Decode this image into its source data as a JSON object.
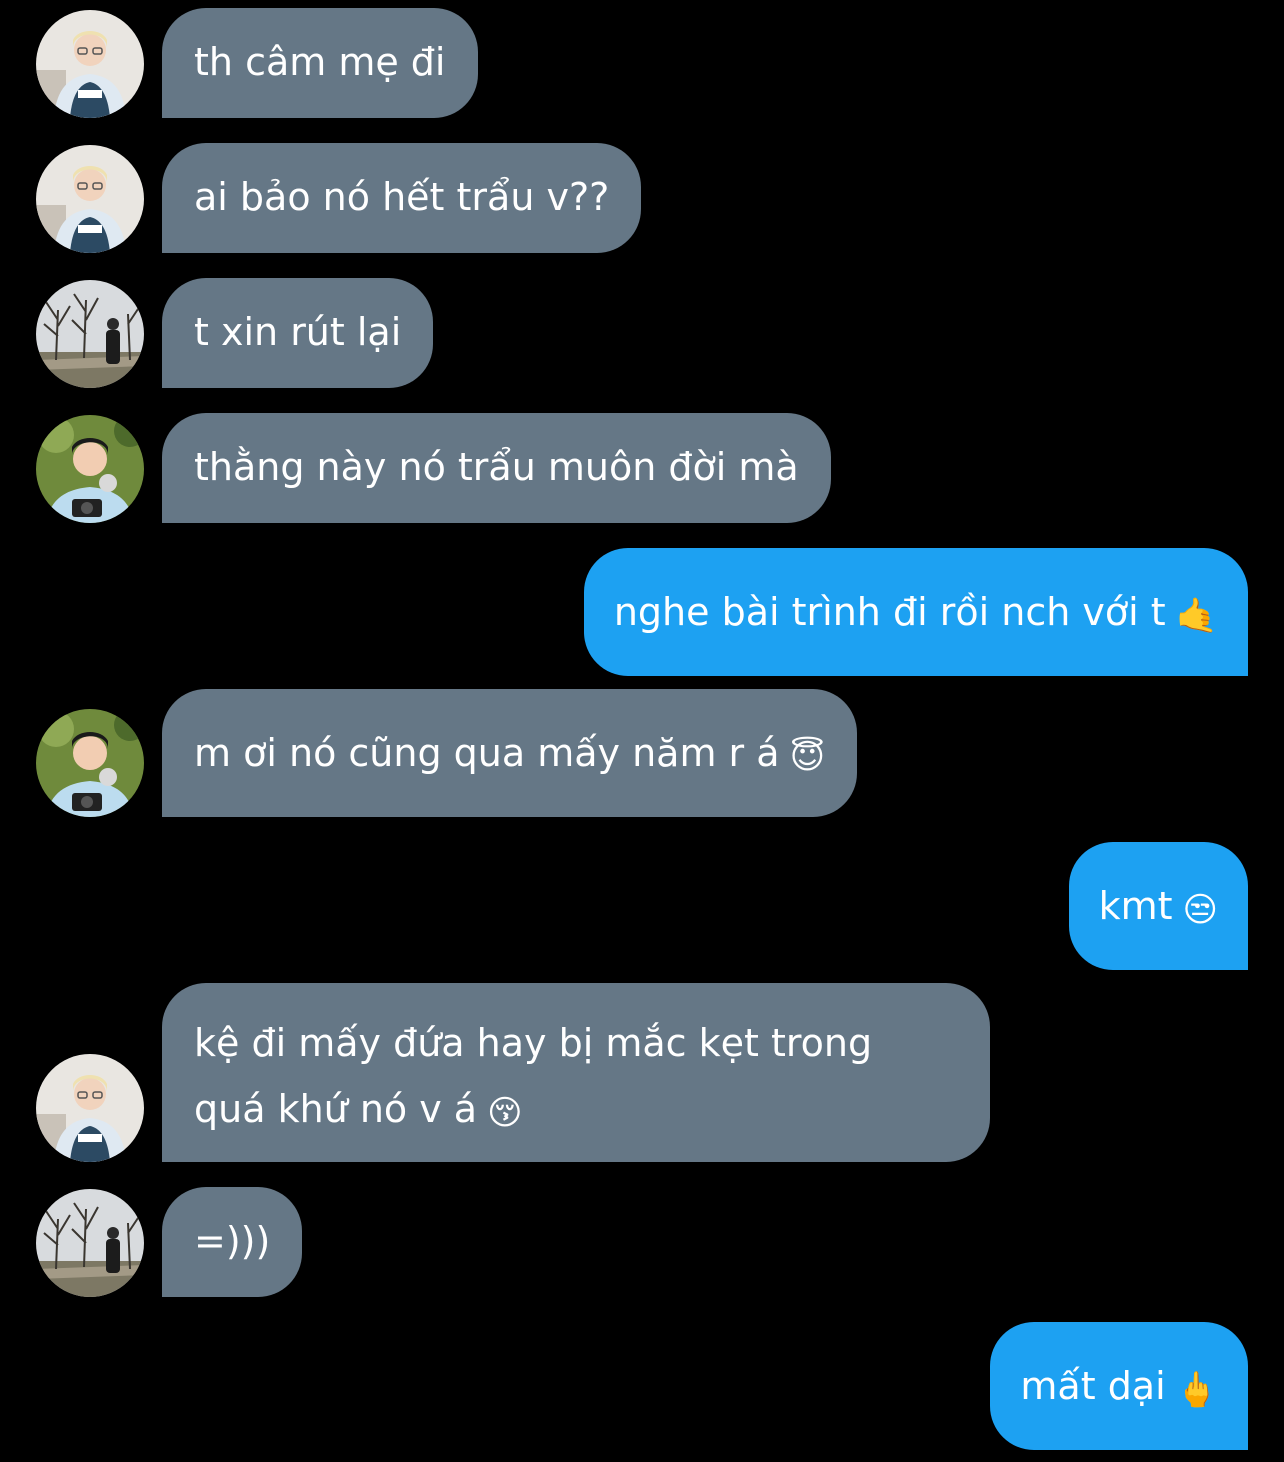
{
  "messages": [
    {
      "id": "m1",
      "direction": "in",
      "sender_avatar": "avatar-blond-jacket",
      "text": "th câm mẹ đi"
    },
    {
      "id": "m2",
      "direction": "in",
      "sender_avatar": "avatar-blond-jacket",
      "text": "ai bảo nó hết trẩu v??"
    },
    {
      "id": "m3",
      "direction": "in",
      "sender_avatar": "avatar-trees-park",
      "text": "t xin rút lại"
    },
    {
      "id": "m4",
      "direction": "in",
      "sender_avatar": "avatar-camera-green",
      "text": "thằng này nó trẩu muôn đời mà"
    },
    {
      "id": "m5",
      "direction": "out",
      "text": "nghe bài trình đi rồi nch với t",
      "emoji": "🤙"
    },
    {
      "id": "m6",
      "direction": "in",
      "sender_avatar": "avatar-camera-green",
      "text": "m ơi nó cũng qua mấy năm r á",
      "emoji": "😇"
    },
    {
      "id": "m7",
      "direction": "out",
      "text": "kmt",
      "emoji": "😒"
    },
    {
      "id": "m8",
      "direction": "in",
      "sender_avatar": "avatar-blond-jacket",
      "line1": "kệ đi mấy đứa hay bị mắc kẹt trong",
      "line2": "quá khứ nó v á",
      "emoji": "😚"
    },
    {
      "id": "m9",
      "direction": "in",
      "sender_avatar": "avatar-trees-park",
      "text": "=)))"
    },
    {
      "id": "m10",
      "direction": "out",
      "text": "mất dại",
      "emoji": "🖕"
    }
  ],
  "colors": {
    "background": "#000000",
    "incoming_bubble": "#657786",
    "outgoing_bubble": "#1da1f2",
    "text": "#ffffff"
  }
}
